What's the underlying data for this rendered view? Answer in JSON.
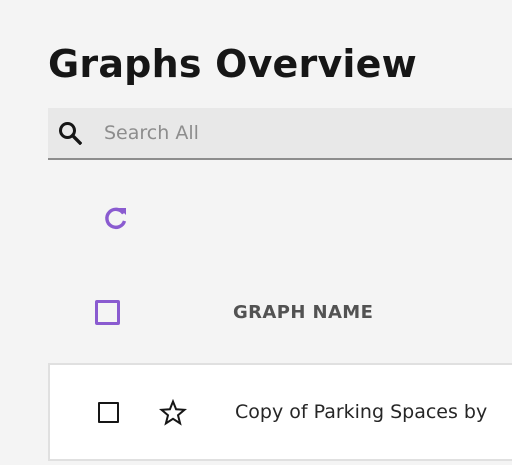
{
  "page": {
    "title": "Graphs Overview"
  },
  "search": {
    "placeholder": "Search All",
    "value": "",
    "icon": "search-icon"
  },
  "toolbar": {
    "refresh_icon": "refresh-icon"
  },
  "table": {
    "columns": [
      {
        "label": "GRAPH NAME"
      }
    ],
    "rows": [
      {
        "checked": false,
        "starred": false,
        "graph_name": "Copy of Parking Spaces by"
      }
    ]
  },
  "colors": {
    "accent": "#8a5bd0",
    "background": "#f4f4f4",
    "text": "#161616",
    "header_text": "#525252"
  }
}
